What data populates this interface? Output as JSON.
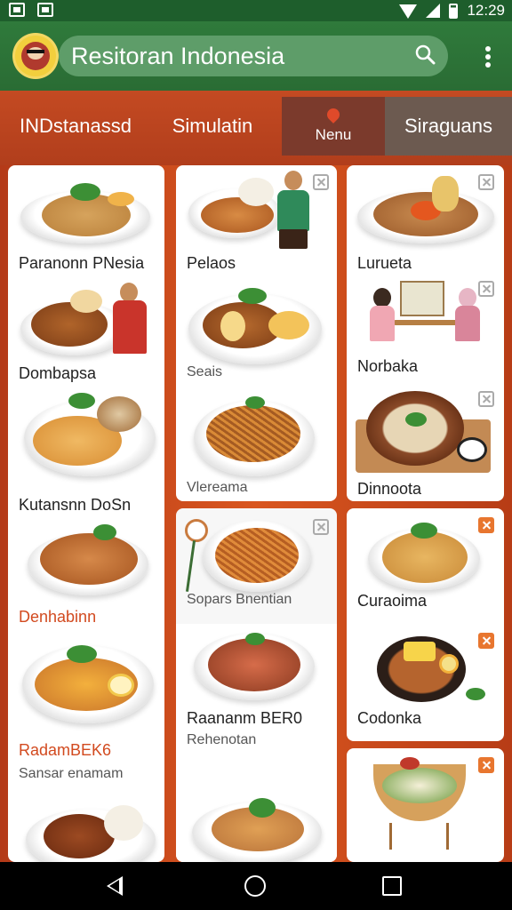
{
  "status_bar": {
    "time": "12:29"
  },
  "app_bar": {
    "search_text": "Resitoran Indonesia"
  },
  "tabs": [
    {
      "label": "INDstanassd"
    },
    {
      "label": "Simulatin"
    },
    {
      "label": "Nenu"
    },
    {
      "label": "Siraguans"
    }
  ],
  "col1": [
    {
      "name": "Paranonn PNesia"
    },
    {
      "name": "Dombapsa"
    },
    {
      "name": "Kutansnn DoSn"
    },
    {
      "name": "Denhabinn"
    },
    {
      "name": "RadamBEK6",
      "sub": "Sansar enamam"
    }
  ],
  "col2": [
    {
      "name": "Pelaos"
    },
    {
      "name": "Seais"
    },
    {
      "name": "Vlereama"
    },
    {
      "name": "Sopars Bnentian"
    },
    {
      "name": "Raananm BER0",
      "sub": "Rehenotan"
    }
  ],
  "col3": [
    {
      "name": "Lurueta"
    },
    {
      "name": "Norbaka"
    },
    {
      "name": "Dinnoota"
    },
    {
      "name": "Curaoima"
    },
    {
      "name": "Codonka"
    }
  ],
  "colors": {
    "primary_green": "#2f7a3b",
    "tab_red": "#c44a22",
    "accent_orange": "#e8762f"
  }
}
